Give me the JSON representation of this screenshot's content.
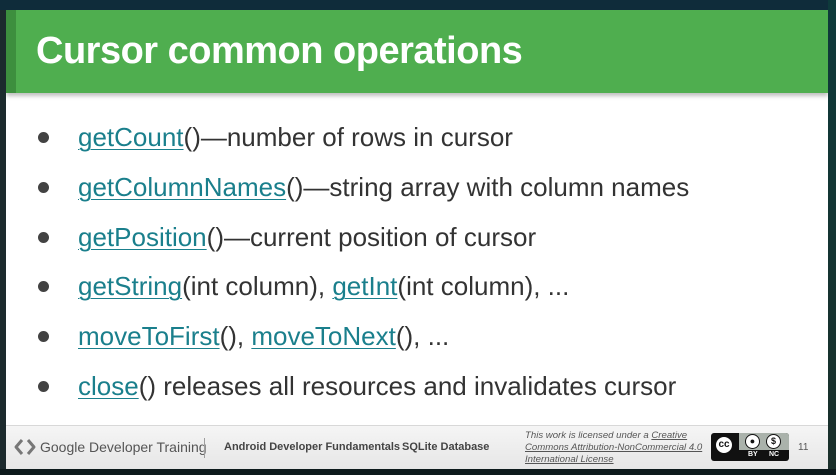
{
  "slide": {
    "title": "Cursor common operations",
    "bullets": [
      {
        "parts": [
          {
            "text": "getCount",
            "link": true
          },
          {
            "text": "()—number of rows in cursor",
            "link": false
          }
        ]
      },
      {
        "parts": [
          {
            "text": "getColumnNames",
            "link": true
          },
          {
            "text": "()—string array with column names",
            "link": false
          }
        ]
      },
      {
        "parts": [
          {
            "text": "getPosition",
            "link": true
          },
          {
            "text": "()—current position of cursor",
            "link": false
          }
        ]
      },
      {
        "parts": [
          {
            "text": "getString",
            "link": true
          },
          {
            "text": "(int column), ",
            "link": false
          },
          {
            "text": "getInt",
            "link": true
          },
          {
            "text": "(int column), ...",
            "link": false
          }
        ]
      },
      {
        "parts": [
          {
            "text": "moveToFirst",
            "link": true
          },
          {
            "text": "(), ",
            "link": false
          },
          {
            "text": "moveToNext",
            "link": true
          },
          {
            "text": "(), ...",
            "link": false
          }
        ]
      },
      {
        "parts": [
          {
            "text": "close",
            "link": true
          },
          {
            "text": "() releases all resources and invalidates cursor",
            "link": false
          }
        ]
      }
    ]
  },
  "footer": {
    "brand": "Google Developer Training",
    "course": "Android Developer Fundamentals",
    "topic": "SQLite Database",
    "license_prefix": "This work is licensed under a ",
    "license_link": "Creative Commons Attribution-NonCommercial 4.0 International License",
    "cc_text": "cc",
    "by_label": "BY",
    "nc_label": "NC",
    "page_number": "11"
  },
  "colors": {
    "title_bar": "#4fae4f",
    "link": "#1a7f8c",
    "body_text": "#333333"
  },
  "icons": [
    "google-developers-logo-icon",
    "creative-commons-icon",
    "attribution-icon",
    "noncommercial-icon"
  ]
}
